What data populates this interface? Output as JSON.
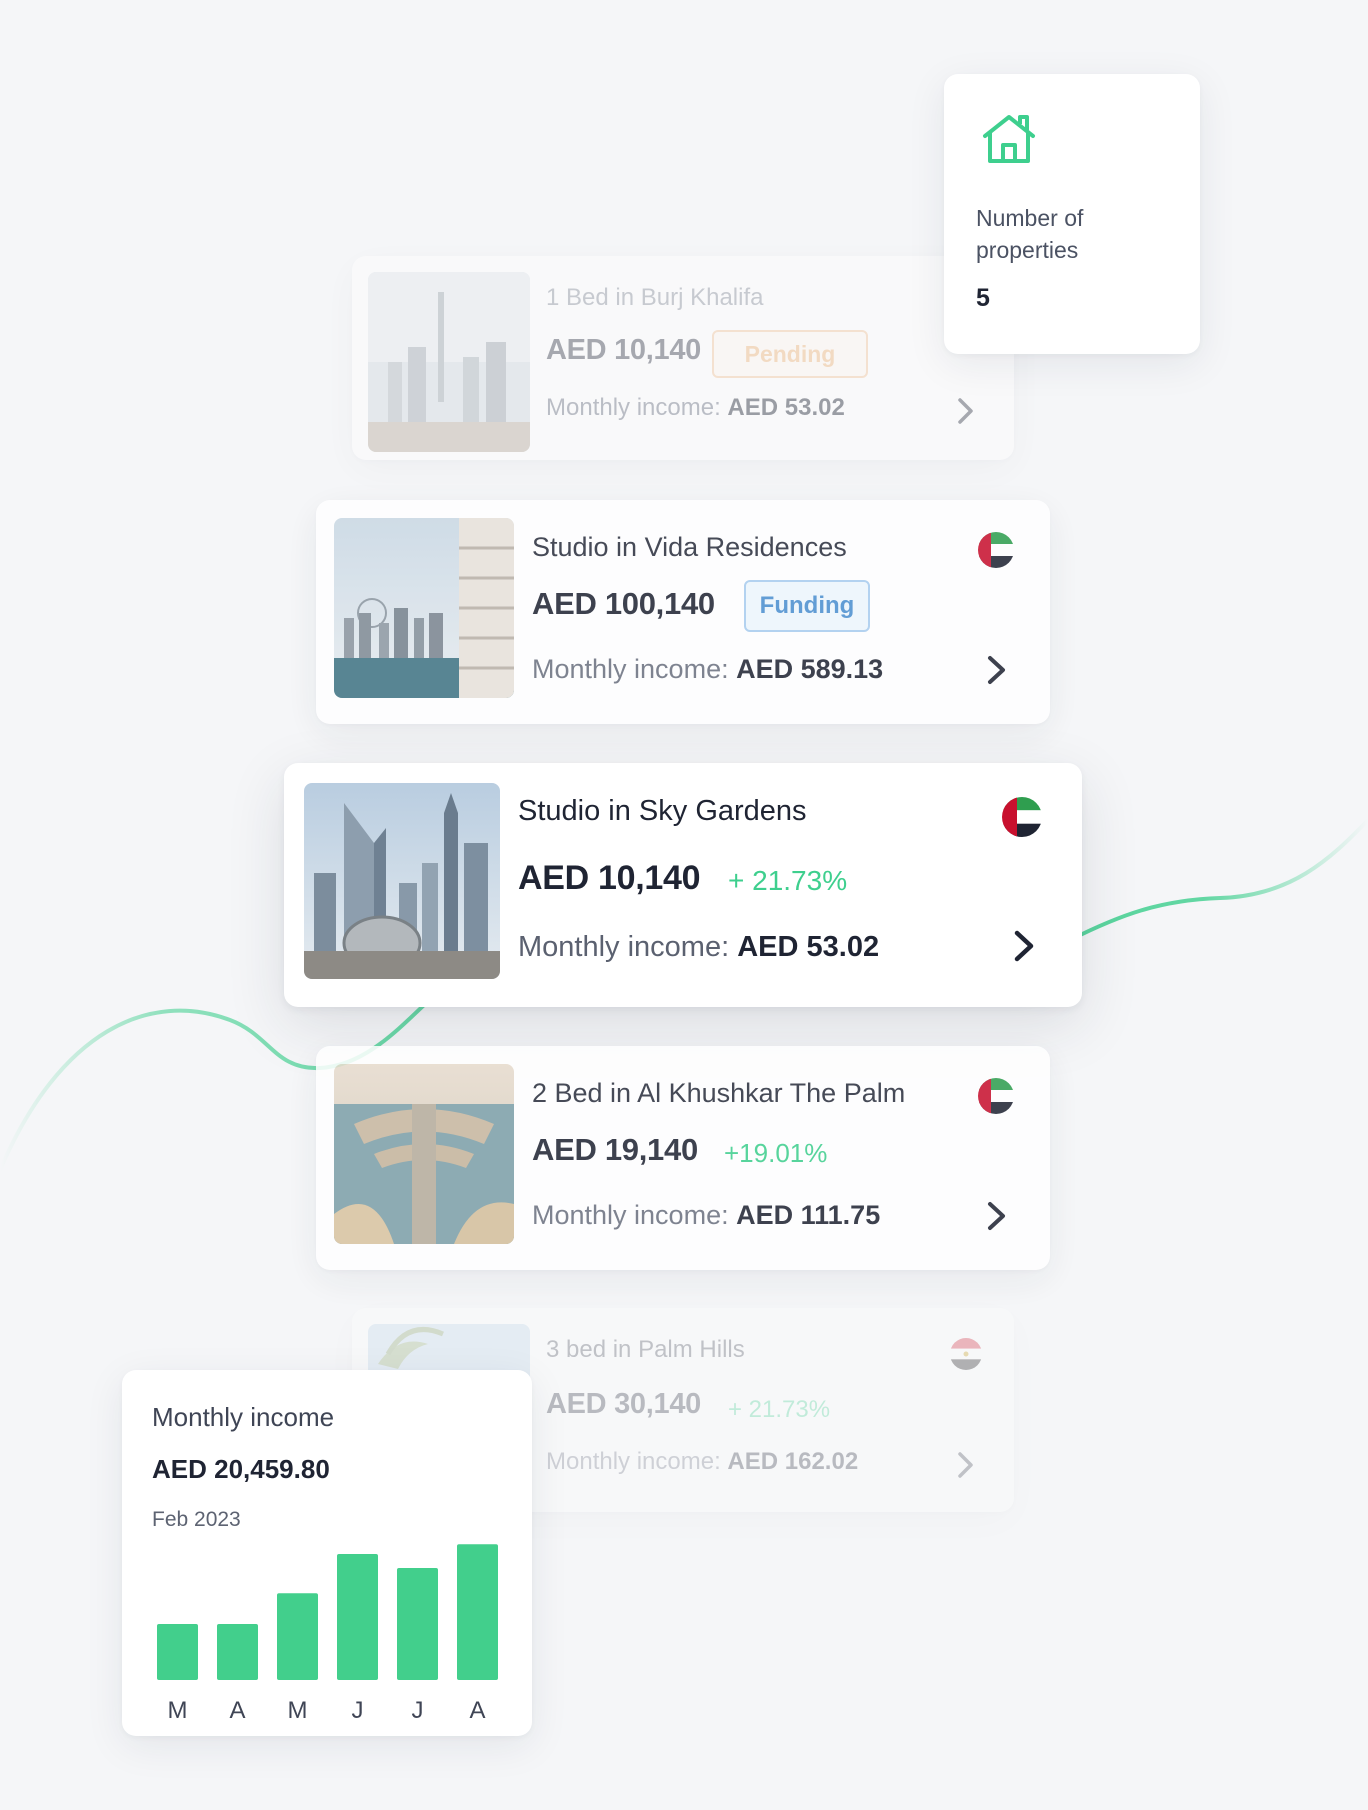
{
  "stats": {
    "icon": "house-icon",
    "label": "Number of properties",
    "value": "5"
  },
  "properties": [
    {
      "title": "1 Bed in Burj Khalifa",
      "price": "AED 10,140",
      "badge": "Pending",
      "income_label": "Monthly income:",
      "income_value": "AED 53.02",
      "image": "city-skyline-photo"
    },
    {
      "title": "Studio in Vida Residences",
      "price": "AED 100,140",
      "badge": "Funding",
      "income_label": "Monthly income:",
      "income_value": "AED 589.13",
      "flag": "uae-flag-icon",
      "image": "marina-tower-photo"
    },
    {
      "title": "Studio in Sky Gardens",
      "price": "AED 10,140",
      "change": "+ 21.73%",
      "income_label": "Monthly income:",
      "income_value": "AED 53.02",
      "flag": "uae-flag-icon",
      "image": "downtown-towers-photo"
    },
    {
      "title": "2 Bed in Al Khushkar The Palm",
      "price": "AED 19,140",
      "change": "+19.01%",
      "income_label": "Monthly income:",
      "income_value": "AED 111.75",
      "flag": "uae-flag-icon",
      "image": "palm-island-photo"
    },
    {
      "title": "3 bed in Palm Hills",
      "price": "AED 30,140",
      "change": "+ 21.73%",
      "income_label": "Monthly income:",
      "income_value": "AED 162.02",
      "flag": "egypt-flag-icon",
      "image": "palm-sky-photo"
    }
  ],
  "income_card": {
    "title": "Monthly income",
    "amount": "AED 20,459.80",
    "date": "Feb 2023"
  },
  "chart_data": {
    "type": "bar",
    "categories": [
      "M",
      "A",
      "M",
      "J",
      "J",
      "A"
    ],
    "values": [
      40,
      40,
      62,
      90,
      80,
      97
    ],
    "ylim": [
      0,
      100
    ],
    "title": "",
    "xlabel": "",
    "ylabel": "",
    "grid": false,
    "color": "#42cf8c"
  },
  "colors": {
    "accent": "#3ecf8e",
    "pending": "#f0b47a",
    "funding": "#4a8fd0",
    "background": "#f5f6f8"
  }
}
